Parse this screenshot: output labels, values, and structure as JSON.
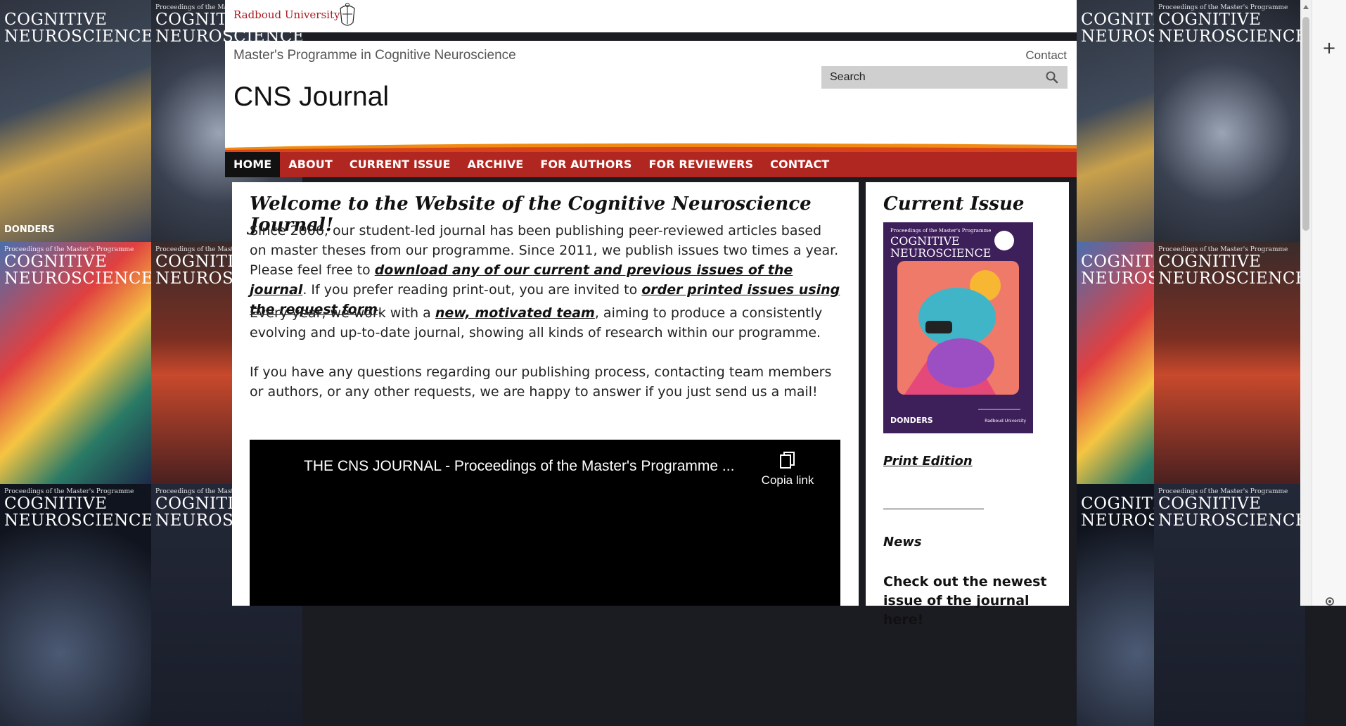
{
  "background_covers": {
    "small_text": "Proceedings of the Master's Programme",
    "big_text_1": "COGNITIVE",
    "big_text_2": "NEUROSCIENCE",
    "footer_left": "DONDERS",
    "footer_right": "Radboud University"
  },
  "topbar": {
    "logo_text": "Radboud University"
  },
  "header": {
    "programme": "Master's Programme in Cognitive Neuroscience",
    "contact": "Contact",
    "site_title": "CNS Journal",
    "search_placeholder": "Search"
  },
  "nav": {
    "items": [
      "HOME",
      "ABOUT",
      "CURRENT ISSUE",
      "ARCHIVE",
      "FOR AUTHORS",
      "FOR REVIEWERS",
      "CONTACT"
    ],
    "active": "HOME"
  },
  "main": {
    "heading": "Welcome to the Website of the Cognitive Neuroscience Journal!",
    "p1_a": "Since 2006, our student-led journal has been publishing peer-reviewed articles based on master theses from our programme. Since 2011, we publish issues two times a year. Please feel free to ",
    "p1_link1": "download any of our current and previous issues of the journal",
    "p1_b": ". If you prefer reading print-out, you are invited to ",
    "p1_link2": "order printed issues using the request form",
    "p1_c": ".",
    "p2_a": "Every year, we work with a ",
    "p2_link": "new, motivated team",
    "p2_b": ", aiming to produce a consistently evolving and up-to-date journal, showing all kinds of research within our programme.",
    "p3": "If you have any questions regarding our publishing process, contacting team members or authors, or any other requests, we are happy to answer if you just send us a mail!",
    "video": {
      "title": "THE CNS JOURNAL - Proceedings of the Master's Programme ...",
      "copy_label": "Copia link"
    }
  },
  "sidebar": {
    "heading": "Current Issue",
    "cover": {
      "small": "Proceedings of the Master's Programme",
      "big1": "COGNITIVE",
      "big2": "NEUROSCIENCE",
      "footer_left": "DONDERS",
      "footer_right": "Radboud University"
    },
    "print_link": "Print Edition",
    "news_label": "News",
    "newest": "Check out the newest issue of the journal here!"
  },
  "colors": {
    "nav_red": "#b02721",
    "nav_active": "#111111",
    "brand_red": "#a61d24",
    "swoosh_orange": "#f08a12"
  }
}
